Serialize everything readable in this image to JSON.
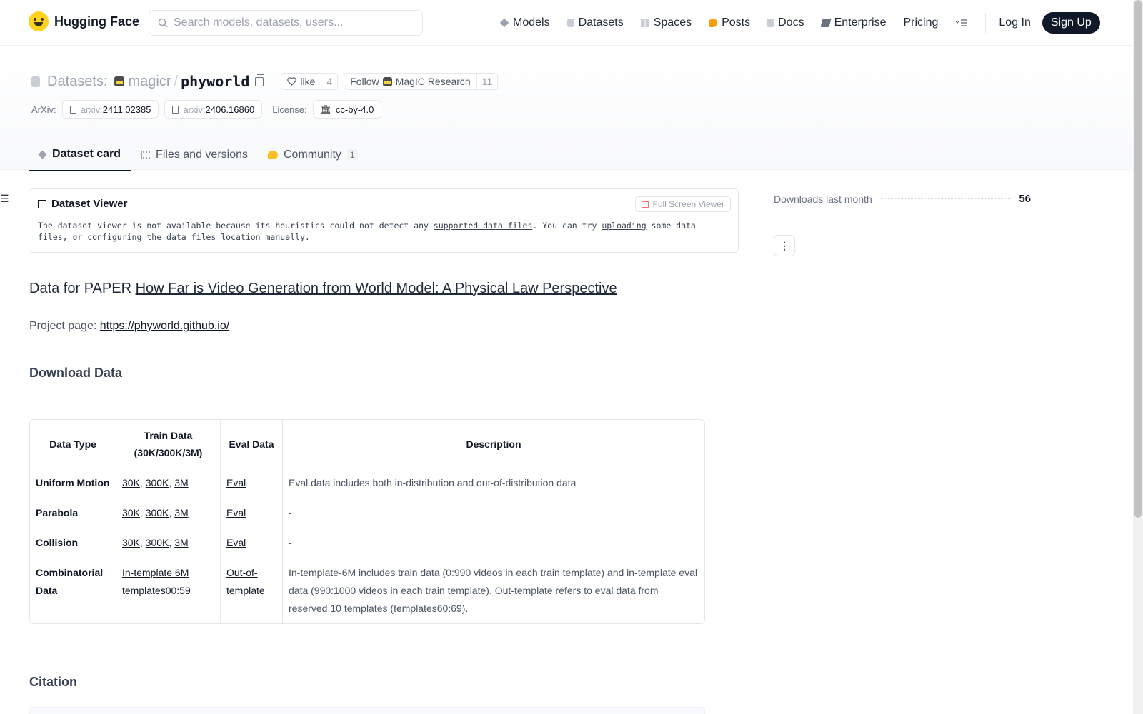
{
  "nav": {
    "logo_text": "Hugging Face",
    "search_placeholder": "Search models, datasets, users...",
    "links": [
      "Models",
      "Datasets",
      "Spaces",
      "Posts",
      "Docs",
      "Enterprise",
      "Pricing"
    ],
    "login": "Log In",
    "signup": "Sign Up"
  },
  "header": {
    "section_label": "Datasets:",
    "org": "magicr",
    "repo": "phyworld",
    "like_label": "like",
    "like_count": "4",
    "follow_label": "Follow",
    "follow_org": "MagIC Research",
    "follow_count": "11",
    "arxiv_label": "ArXiv:",
    "arxiv": [
      {
        "prefix": "arxiv:",
        "id": "2411.02385"
      },
      {
        "prefix": "arxiv:",
        "id": "2406.16860"
      }
    ],
    "license_label": "License:",
    "license": "cc-by-4.0",
    "tabs": [
      {
        "label": "Dataset card",
        "active": true
      },
      {
        "label": "Files and versions",
        "active": false
      },
      {
        "label": "Community",
        "count": "1",
        "active": false
      }
    ]
  },
  "viewer": {
    "title": "Dataset Viewer",
    "fullscreen": "Full Screen Viewer",
    "msg_1": "The dataset viewer is not available because its heuristics could not detect any ",
    "link_supported": "supported data files",
    "msg_2": ". You can try ",
    "link_uploading": "uploading",
    "msg_3": " some data files, or ",
    "link_configuring": "configuring",
    "msg_4": " the data files location manually."
  },
  "card": {
    "paper_prefix": "Data for PAPER ",
    "paper_title": "How Far is Video Generation from World Model: A Physical Law Perspective",
    "project_label": "Project page: ",
    "project_url": "https://phyworld.github.io/",
    "download_heading": "Download Data",
    "citation_heading": "Citation",
    "table": {
      "headers": [
        "Data Type",
        "Train Data (30K/300K/3M)",
        "Eval Data",
        "Description"
      ],
      "rows": [
        {
          "type": "Uniform Motion",
          "train": [
            "30K",
            "300K",
            "3M"
          ],
          "eval": "Eval",
          "desc": "Eval data includes both in-distribution and out-of-distribution data"
        },
        {
          "type": "Parabola",
          "train": [
            "30K",
            "300K",
            "3M"
          ],
          "eval": "Eval",
          "desc": "-"
        },
        {
          "type": "Collision",
          "train": [
            "30K",
            "300K",
            "3M"
          ],
          "eval": "Eval",
          "desc": "-"
        },
        {
          "type": "Combinatorial Data",
          "train_single": "In-template 6M templates00:59",
          "eval": "Out-of-template",
          "desc": "In-template-6M includes train data (0:990 videos in each train template) and in-template eval data (990:1000 videos in each train template). Out-template refers to eval data from reserved 10 templates (templates60:69)."
        }
      ]
    }
  },
  "sidebar": {
    "downloads_label": "Downloads last month",
    "downloads_value": "56",
    "more_label": "⋮"
  }
}
